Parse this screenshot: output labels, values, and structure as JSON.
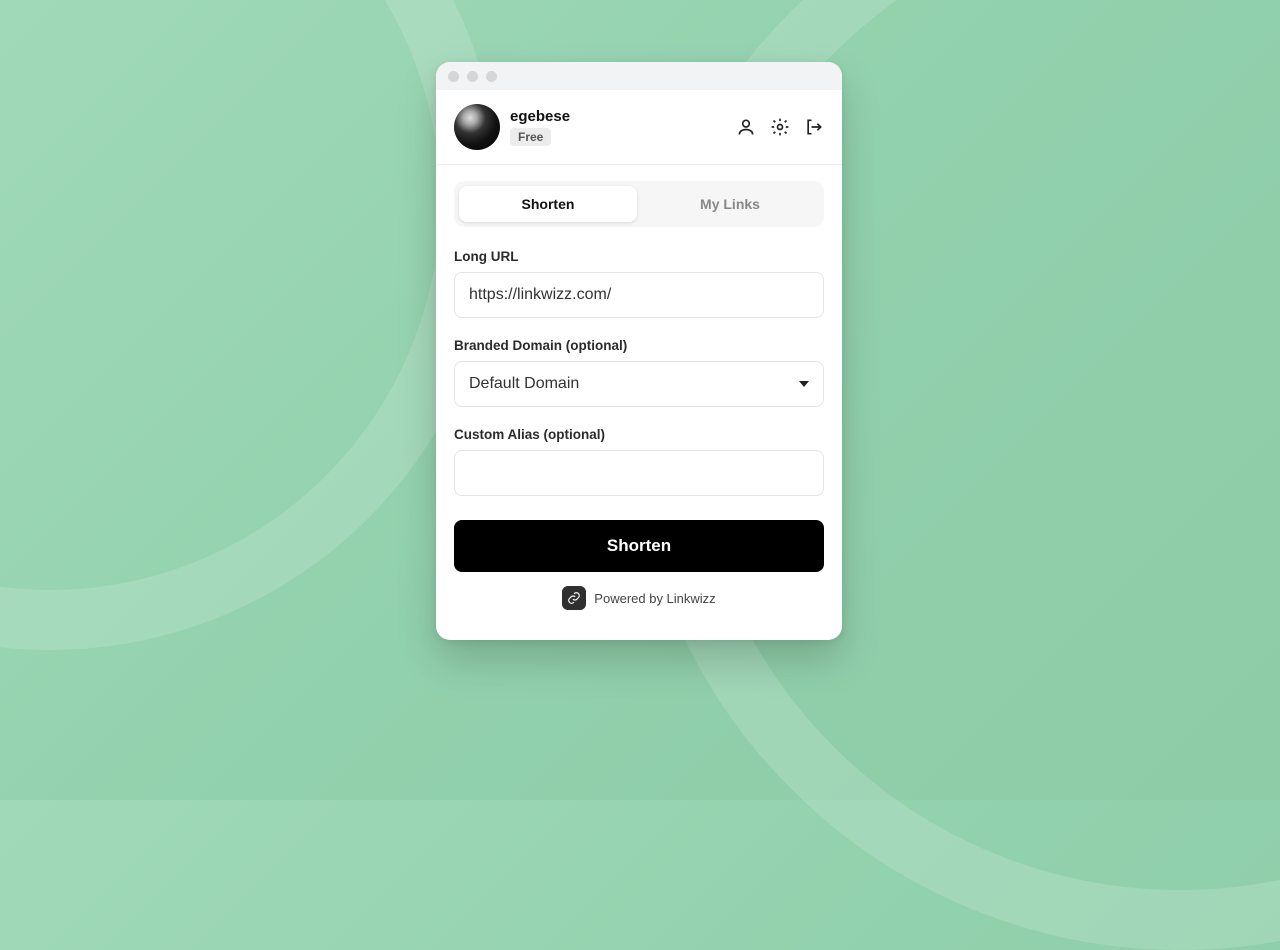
{
  "header": {
    "username": "egebese",
    "plan": "Free"
  },
  "tabs": {
    "shorten": "Shorten",
    "mylinks": "My Links"
  },
  "form": {
    "long_url_label": "Long URL",
    "long_url_value": "https://linkwizz.com/",
    "branded_label": "Branded Domain (optional)",
    "branded_selected": "Default Domain",
    "alias_label": "Custom Alias (optional)",
    "alias_value": "",
    "submit_label": "Shorten"
  },
  "footer": {
    "text": "Powered by Linkwizz"
  }
}
